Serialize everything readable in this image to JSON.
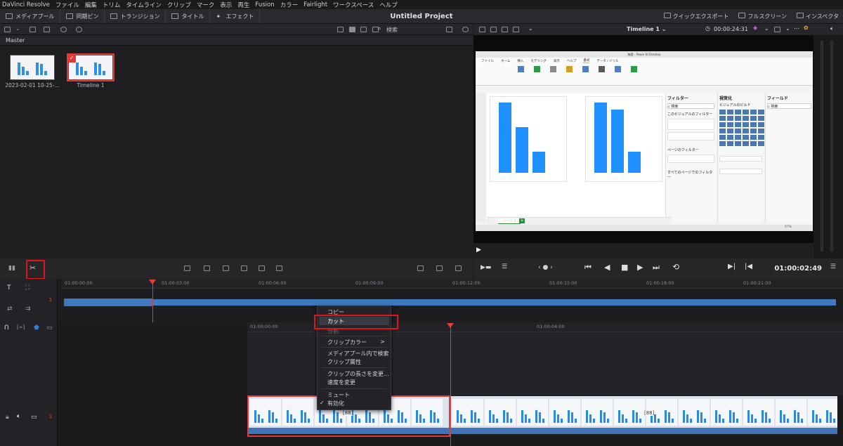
{
  "menu": [
    "DaVinci Resolve",
    "ファイル",
    "編集",
    "トリム",
    "タイムライン",
    "クリップ",
    "マーク",
    "表示",
    "再生",
    "Fusion",
    "カラー",
    "Fairlight",
    "ワークスペース",
    "ヘルプ"
  ],
  "pagebar": {
    "buttons": [
      "メディアプール",
      "同期ビン",
      "トランジション",
      "タイトル",
      "エフェクト"
    ],
    "project_title": "Untitled Project",
    "right_buttons": [
      "クイックエクスポート",
      "フルスクリーン",
      "インスペクタ"
    ]
  },
  "media_toolbar": {
    "search_label": "検索"
  },
  "viewer_header": {
    "timeline_name": "Timeline 1",
    "timecode": "00:00:24:31"
  },
  "media_pool": {
    "bin_name": "Master",
    "clips": [
      {
        "label": "2023-02-01 10-25-..."
      },
      {
        "label": "Timeline 1"
      }
    ]
  },
  "pbi": {
    "window_title": "無題 - Power BI Desktop",
    "tabs": [
      "ファイル",
      "ホーム",
      "挿入",
      "モデリング",
      "表示",
      "ヘルプ",
      "書式",
      "データ / ドリル"
    ],
    "filters_title": "フィルター",
    "visual_title": "視覚化",
    "visual_sub": "ビジュアルのビルド",
    "fields_title": "フィールド",
    "search_placeholder": "検索",
    "filter_items": [
      "このビジュアルのフィルター",
      "ページのフィルター",
      "すべてのページでのフィルター"
    ],
    "page_tab": "ページ 1",
    "zoom": "57%",
    "chart1": {
      "values": [
        100,
        65,
        30
      ]
    },
    "chart2": {
      "values": [
        100,
        90,
        30
      ]
    }
  },
  "transport": {
    "timecode": "01:00:02:49"
  },
  "upper_timeline": {
    "ticks": [
      "01:00:00:00",
      "01:00:03:00",
      "01:00:06:00",
      "01:00:09:00",
      "01:00:12:00",
      "01:00:15:00",
      "01:00:18:00",
      "01:00:21:00"
    ],
    "track_index": "1"
  },
  "lower_timeline": {
    "ticks": [
      "01:00:00:00",
      "01:00:04:00"
    ],
    "track_index": "1",
    "edit_marker": "[88]"
  },
  "context_menu": {
    "items": [
      {
        "label": "コピー",
        "state": "normal"
      },
      {
        "label": "カット",
        "state": "highlighted"
      },
      {
        "label": "分割",
        "state": "disabled"
      },
      {
        "label": "クリップカラー",
        "state": "submenu"
      },
      {
        "label": "メディアプール内で検索",
        "state": "normal"
      },
      {
        "label": "クリップ属性",
        "state": "normal"
      },
      {
        "label": "クリップの長さを変更...",
        "state": "normal"
      },
      {
        "label": "速度を変更",
        "state": "normal"
      },
      {
        "label": "ミュート",
        "state": "normal"
      },
      {
        "label": "有効化",
        "state": "checked"
      }
    ],
    "check_mark": "✓",
    "submenu_arrow": ">"
  }
}
